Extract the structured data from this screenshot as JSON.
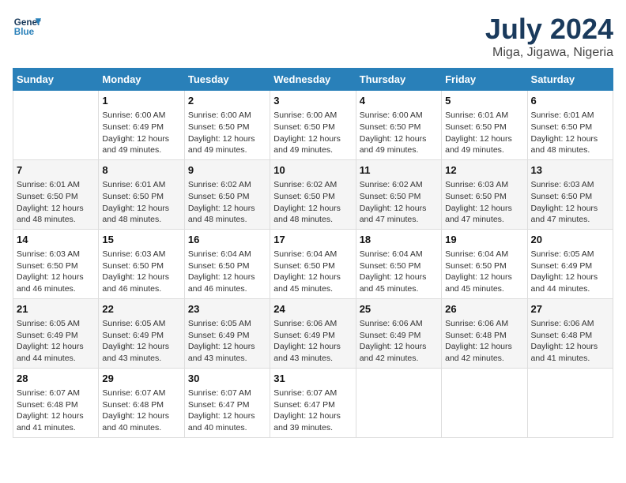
{
  "header": {
    "logo_line1": "General",
    "logo_line2": "Blue",
    "main_title": "July 2024",
    "subtitle": "Miga, Jigawa, Nigeria"
  },
  "days_of_week": [
    "Sunday",
    "Monday",
    "Tuesday",
    "Wednesday",
    "Thursday",
    "Friday",
    "Saturday"
  ],
  "weeks": [
    [
      {
        "day": "",
        "sunrise": "",
        "sunset": "",
        "daylight": ""
      },
      {
        "day": "1",
        "sunrise": "Sunrise: 6:00 AM",
        "sunset": "Sunset: 6:49 PM",
        "daylight": "Daylight: 12 hours and 49 minutes."
      },
      {
        "day": "2",
        "sunrise": "Sunrise: 6:00 AM",
        "sunset": "Sunset: 6:50 PM",
        "daylight": "Daylight: 12 hours and 49 minutes."
      },
      {
        "day": "3",
        "sunrise": "Sunrise: 6:00 AM",
        "sunset": "Sunset: 6:50 PM",
        "daylight": "Daylight: 12 hours and 49 minutes."
      },
      {
        "day": "4",
        "sunrise": "Sunrise: 6:00 AM",
        "sunset": "Sunset: 6:50 PM",
        "daylight": "Daylight: 12 hours and 49 minutes."
      },
      {
        "day": "5",
        "sunrise": "Sunrise: 6:01 AM",
        "sunset": "Sunset: 6:50 PM",
        "daylight": "Daylight: 12 hours and 49 minutes."
      },
      {
        "day": "6",
        "sunrise": "Sunrise: 6:01 AM",
        "sunset": "Sunset: 6:50 PM",
        "daylight": "Daylight: 12 hours and 48 minutes."
      }
    ],
    [
      {
        "day": "7",
        "sunrise": "Sunrise: 6:01 AM",
        "sunset": "Sunset: 6:50 PM",
        "daylight": "Daylight: 12 hours and 48 minutes."
      },
      {
        "day": "8",
        "sunrise": "Sunrise: 6:01 AM",
        "sunset": "Sunset: 6:50 PM",
        "daylight": "Daylight: 12 hours and 48 minutes."
      },
      {
        "day": "9",
        "sunrise": "Sunrise: 6:02 AM",
        "sunset": "Sunset: 6:50 PM",
        "daylight": "Daylight: 12 hours and 48 minutes."
      },
      {
        "day": "10",
        "sunrise": "Sunrise: 6:02 AM",
        "sunset": "Sunset: 6:50 PM",
        "daylight": "Daylight: 12 hours and 48 minutes."
      },
      {
        "day": "11",
        "sunrise": "Sunrise: 6:02 AM",
        "sunset": "Sunset: 6:50 PM",
        "daylight": "Daylight: 12 hours and 47 minutes."
      },
      {
        "day": "12",
        "sunrise": "Sunrise: 6:03 AM",
        "sunset": "Sunset: 6:50 PM",
        "daylight": "Daylight: 12 hours and 47 minutes."
      },
      {
        "day": "13",
        "sunrise": "Sunrise: 6:03 AM",
        "sunset": "Sunset: 6:50 PM",
        "daylight": "Daylight: 12 hours and 47 minutes."
      }
    ],
    [
      {
        "day": "14",
        "sunrise": "Sunrise: 6:03 AM",
        "sunset": "Sunset: 6:50 PM",
        "daylight": "Daylight: 12 hours and 46 minutes."
      },
      {
        "day": "15",
        "sunrise": "Sunrise: 6:03 AM",
        "sunset": "Sunset: 6:50 PM",
        "daylight": "Daylight: 12 hours and 46 minutes."
      },
      {
        "day": "16",
        "sunrise": "Sunrise: 6:04 AM",
        "sunset": "Sunset: 6:50 PM",
        "daylight": "Daylight: 12 hours and 46 minutes."
      },
      {
        "day": "17",
        "sunrise": "Sunrise: 6:04 AM",
        "sunset": "Sunset: 6:50 PM",
        "daylight": "Daylight: 12 hours and 45 minutes."
      },
      {
        "day": "18",
        "sunrise": "Sunrise: 6:04 AM",
        "sunset": "Sunset: 6:50 PM",
        "daylight": "Daylight: 12 hours and 45 minutes."
      },
      {
        "day": "19",
        "sunrise": "Sunrise: 6:04 AM",
        "sunset": "Sunset: 6:50 PM",
        "daylight": "Daylight: 12 hours and 45 minutes."
      },
      {
        "day": "20",
        "sunrise": "Sunrise: 6:05 AM",
        "sunset": "Sunset: 6:49 PM",
        "daylight": "Daylight: 12 hours and 44 minutes."
      }
    ],
    [
      {
        "day": "21",
        "sunrise": "Sunrise: 6:05 AM",
        "sunset": "Sunset: 6:49 PM",
        "daylight": "Daylight: 12 hours and 44 minutes."
      },
      {
        "day": "22",
        "sunrise": "Sunrise: 6:05 AM",
        "sunset": "Sunset: 6:49 PM",
        "daylight": "Daylight: 12 hours and 43 minutes."
      },
      {
        "day": "23",
        "sunrise": "Sunrise: 6:05 AM",
        "sunset": "Sunset: 6:49 PM",
        "daylight": "Daylight: 12 hours and 43 minutes."
      },
      {
        "day": "24",
        "sunrise": "Sunrise: 6:06 AM",
        "sunset": "Sunset: 6:49 PM",
        "daylight": "Daylight: 12 hours and 43 minutes."
      },
      {
        "day": "25",
        "sunrise": "Sunrise: 6:06 AM",
        "sunset": "Sunset: 6:49 PM",
        "daylight": "Daylight: 12 hours and 42 minutes."
      },
      {
        "day": "26",
        "sunrise": "Sunrise: 6:06 AM",
        "sunset": "Sunset: 6:48 PM",
        "daylight": "Daylight: 12 hours and 42 minutes."
      },
      {
        "day": "27",
        "sunrise": "Sunrise: 6:06 AM",
        "sunset": "Sunset: 6:48 PM",
        "daylight": "Daylight: 12 hours and 41 minutes."
      }
    ],
    [
      {
        "day": "28",
        "sunrise": "Sunrise: 6:07 AM",
        "sunset": "Sunset: 6:48 PM",
        "daylight": "Daylight: 12 hours and 41 minutes."
      },
      {
        "day": "29",
        "sunrise": "Sunrise: 6:07 AM",
        "sunset": "Sunset: 6:48 PM",
        "daylight": "Daylight: 12 hours and 40 minutes."
      },
      {
        "day": "30",
        "sunrise": "Sunrise: 6:07 AM",
        "sunset": "Sunset: 6:47 PM",
        "daylight": "Daylight: 12 hours and 40 minutes."
      },
      {
        "day": "31",
        "sunrise": "Sunrise: 6:07 AM",
        "sunset": "Sunset: 6:47 PM",
        "daylight": "Daylight: 12 hours and 39 minutes."
      },
      {
        "day": "",
        "sunrise": "",
        "sunset": "",
        "daylight": ""
      },
      {
        "day": "",
        "sunrise": "",
        "sunset": "",
        "daylight": ""
      },
      {
        "day": "",
        "sunrise": "",
        "sunset": "",
        "daylight": ""
      }
    ]
  ]
}
